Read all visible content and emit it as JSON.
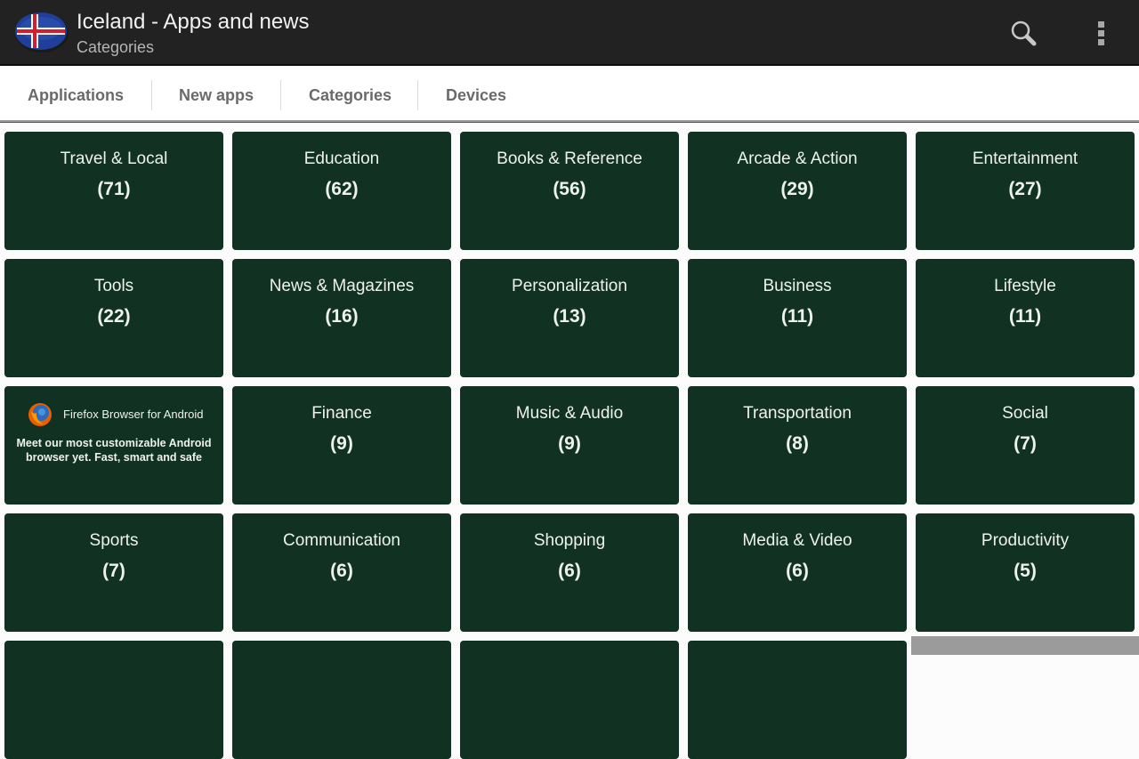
{
  "header": {
    "title": "Iceland - Apps and news",
    "subtitle": "Categories",
    "logo_icon": "iceland-flag-icon",
    "actions": [
      {
        "name": "search-icon"
      },
      {
        "name": "overflow-menu-icon"
      }
    ]
  },
  "tabs": [
    {
      "label": "Applications"
    },
    {
      "label": "New apps"
    },
    {
      "label": "Categories",
      "selected": true
    },
    {
      "label": "Devices"
    }
  ],
  "categories": [
    {
      "name": "Travel & Local",
      "count": "(71)"
    },
    {
      "name": "Education",
      "count": "(62)"
    },
    {
      "name": "Books & Reference",
      "count": "(56)"
    },
    {
      "name": "Arcade & Action",
      "count": "(29)"
    },
    {
      "name": "Entertainment",
      "count": "(27)"
    },
    {
      "name": "Tools",
      "count": "(22)"
    },
    {
      "name": "News & Magazines",
      "count": "(16)"
    },
    {
      "name": "Personalization",
      "count": "(13)"
    },
    {
      "name": "Business",
      "count": "(11)"
    },
    {
      "name": "Lifestyle",
      "count": "(11)"
    },
    {
      "ad": true,
      "title": "Firefox Browser for Android",
      "text": "Meet our most customizable Android browser yet. Fast, smart and safe",
      "icon": "firefox-icon"
    },
    {
      "name": "Finance",
      "count": "(9)"
    },
    {
      "name": "Music & Audio",
      "count": "(9)"
    },
    {
      "name": "Transportation",
      "count": "(8)"
    },
    {
      "name": "Social",
      "count": "(7)"
    },
    {
      "name": "Sports",
      "count": "(7)"
    },
    {
      "name": "Communication",
      "count": "(6)"
    },
    {
      "name": "Shopping",
      "count": "(6)"
    },
    {
      "name": "Media & Video",
      "count": "(6)"
    },
    {
      "name": "Productivity",
      "count": "(5)"
    },
    {
      "name": "",
      "count": ""
    },
    {
      "name": "",
      "count": ""
    },
    {
      "name": "",
      "count": ""
    },
    {
      "name": "",
      "count": ""
    }
  ],
  "colors": {
    "tile_bg": "#113222",
    "actionbar_bg": "#222222",
    "tab_text": "#6a6a6a"
  }
}
